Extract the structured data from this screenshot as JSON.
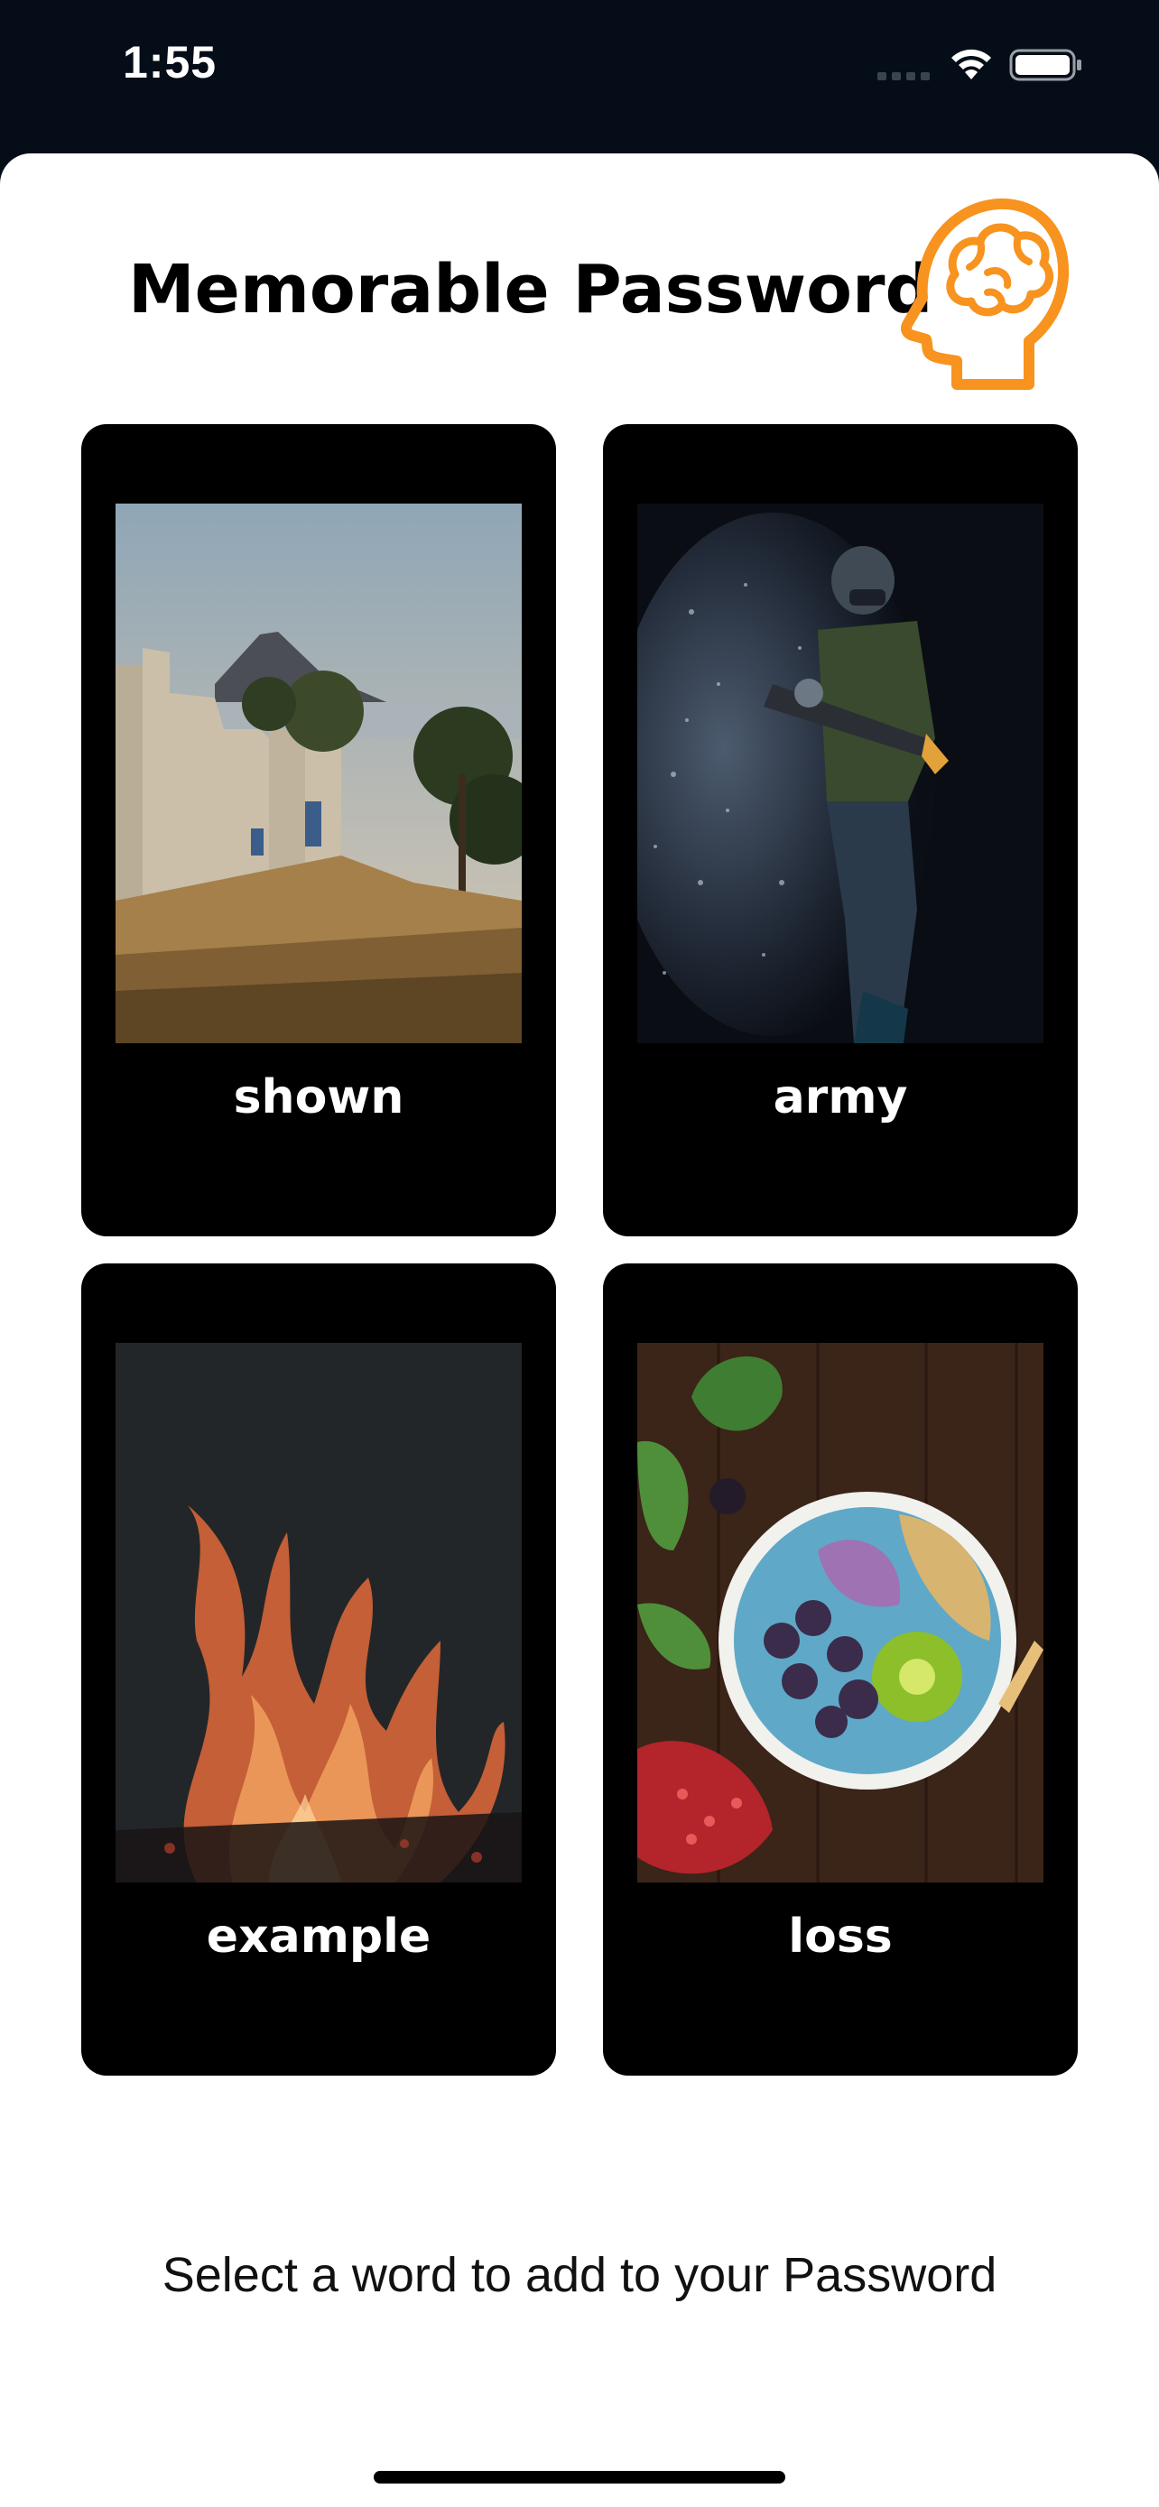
{
  "status_bar": {
    "time": "1:55"
  },
  "header": {
    "title": "Memorable Password",
    "logo_icon": "brain-head-icon",
    "accent_color": "#f7931e"
  },
  "cards": [
    {
      "word": "shown",
      "image": "coastal villa with mountain"
    },
    {
      "word": "army",
      "image": "soldier dispersion art"
    },
    {
      "word": "example",
      "image": "fire flames"
    },
    {
      "word": "loss",
      "image": "smoothie bowl with fruit"
    }
  ],
  "instruction": "Select a word to add to your Password"
}
